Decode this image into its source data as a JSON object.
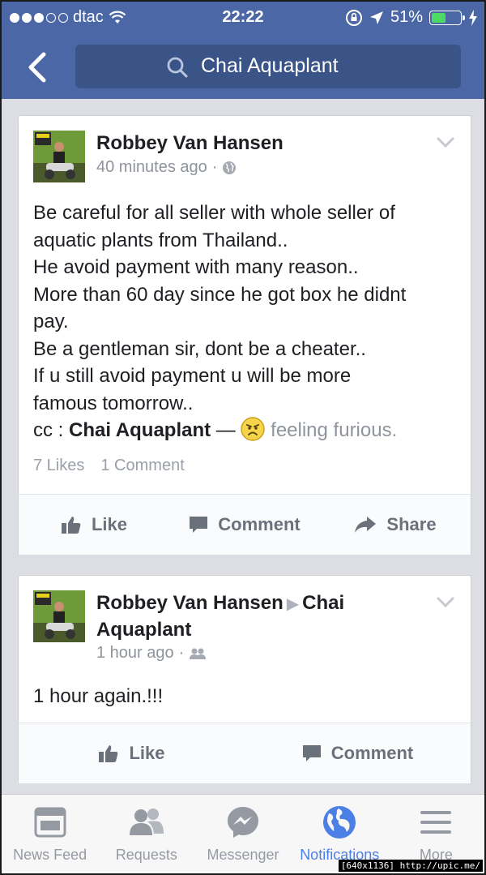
{
  "status_bar": {
    "carrier": "dtac",
    "time": "22:22",
    "battery_percent": "51%",
    "battery_level": 0.51,
    "signal_bars_filled": 3,
    "signal_bars_total": 5
  },
  "header": {
    "search_query": "Chai Aquaplant",
    "color": "#4b67a5"
  },
  "posts": [
    {
      "author": "Robbey Van Hansen",
      "time": "40 minutes ago",
      "privacy_icon": "globe-icon",
      "text_lines": [
        "Be careful for all seller with whole seller of",
        "aquatic plants from Thailand..",
        "He avoid payment with many reason..",
        "More than 60 day since he got box he didnt",
        "pay.",
        "Be a gentleman sir, dont be a cheater..",
        "If u still avoid payment u will be more",
        "famous tomorrow.."
      ],
      "cc_prefix": "cc : ",
      "cc_tag": "Chai Aquaplant",
      "dash": " — ",
      "feeling": "feeling furious.",
      "likes": "7 Likes",
      "comments": "1 Comment",
      "actions": {
        "like": "Like",
        "comment": "Comment",
        "share": "Share"
      }
    },
    {
      "author": "Robbey Van Hansen",
      "target_line1": "Chai",
      "target_line2": "Aquaplant",
      "time": "1 hour ago",
      "privacy_icon": "friends-icon",
      "text": "1 hour again.!!!",
      "actions": {
        "like": "Like",
        "comment": "Comment"
      }
    }
  ],
  "tabbar": [
    {
      "label": "News Feed",
      "icon": "news-feed-icon",
      "active": false
    },
    {
      "label": "Requests",
      "icon": "friend-requests-icon",
      "active": false
    },
    {
      "label": "Messenger",
      "icon": "messenger-icon",
      "active": false
    },
    {
      "label": "Notifications",
      "icon": "globe-notifications-icon",
      "active": true
    },
    {
      "label": "More",
      "icon": "menu-icon",
      "active": false
    }
  ],
  "watermark": "[640x1136] http://upic.me/",
  "colors": {
    "active_tab": "#4c7fe5",
    "battery_fill": "#4cd964"
  }
}
